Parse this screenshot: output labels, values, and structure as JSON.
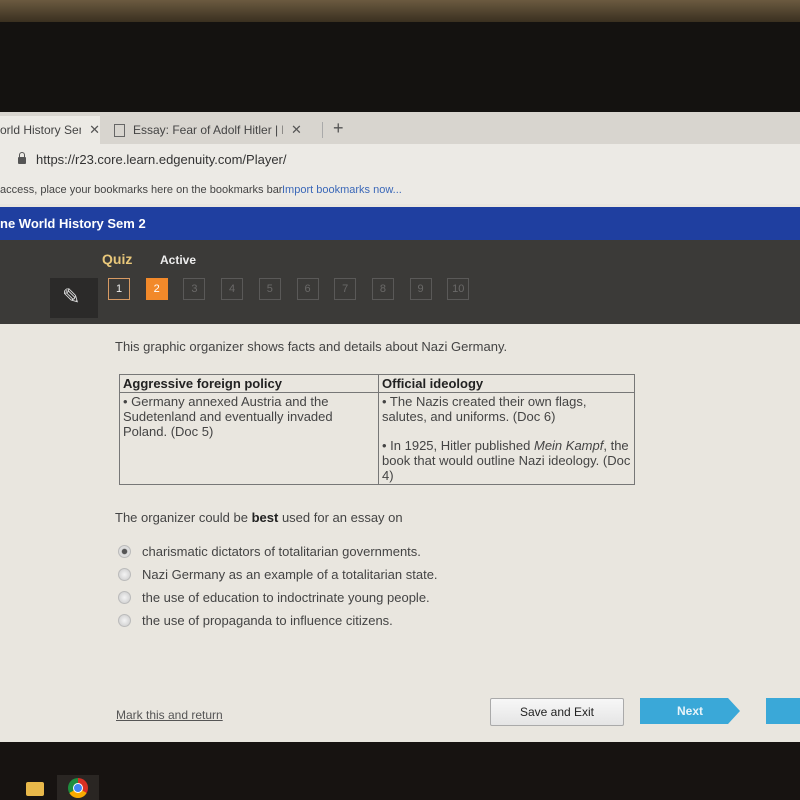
{
  "browser": {
    "tabs": [
      {
        "title": "orld History Sem",
        "active": true
      },
      {
        "title": "Essay: Fear of Adolf Hitler | Phila",
        "active": false
      }
    ],
    "close_glyph": "✕",
    "new_tab_glyph": "+",
    "url": "https://r23.core.learn.edgenuity.com/Player/",
    "bookmarks_bar": {
      "message": "access, place your bookmarks here on the bookmarks bar.",
      "import_link": "Import bookmarks now..."
    }
  },
  "course": {
    "title": "ne World History Sem 2"
  },
  "quiz": {
    "label": "Quiz",
    "status": "Active",
    "pencil_glyph": "✎",
    "questions": [
      {
        "n": "1",
        "state": "done"
      },
      {
        "n": "2",
        "state": "current"
      },
      {
        "n": "3",
        "state": "locked"
      },
      {
        "n": "4",
        "state": "locked"
      },
      {
        "n": "5",
        "state": "locked"
      },
      {
        "n": "6",
        "state": "locked"
      },
      {
        "n": "7",
        "state": "locked"
      },
      {
        "n": "8",
        "state": "locked"
      },
      {
        "n": "9",
        "state": "locked"
      },
      {
        "n": "10",
        "state": "locked"
      }
    ]
  },
  "content": {
    "prompt": "This graphic organizer shows facts and details about Nazi Germany.",
    "organizer": {
      "col1_header": "Aggressive foreign policy",
      "col2_header": "Official ideology",
      "col1_text": "• Germany annexed Austria and the Sudetenland and eventually invaded Poland. (Doc 5)",
      "col2_item1": "• The Nazis created their own flags, salutes, and uniforms. (Doc 6)",
      "col2_item2_pre": "• In 1925, Hitler published ",
      "col2_item2_em": "Mein Kampf",
      "col2_item2_post": ", the book that would outline Nazi ideology. (Doc 4)"
    },
    "question_pre": "The organizer could be ",
    "question_bold": "best",
    "question_post": " used for an essay on",
    "options": [
      {
        "label": "charismatic dictators of totalitarian governments.",
        "selected": true
      },
      {
        "label": "Nazi Germany as an example of a totalitarian state.",
        "selected": false
      },
      {
        "label": "the use of education to indoctrinate young people.",
        "selected": false
      },
      {
        "label": "the use of propaganda to influence citizens.",
        "selected": false
      }
    ]
  },
  "footer": {
    "mark_link": "Mark this and return",
    "save_exit": "Save and Exit",
    "next": "Next"
  }
}
